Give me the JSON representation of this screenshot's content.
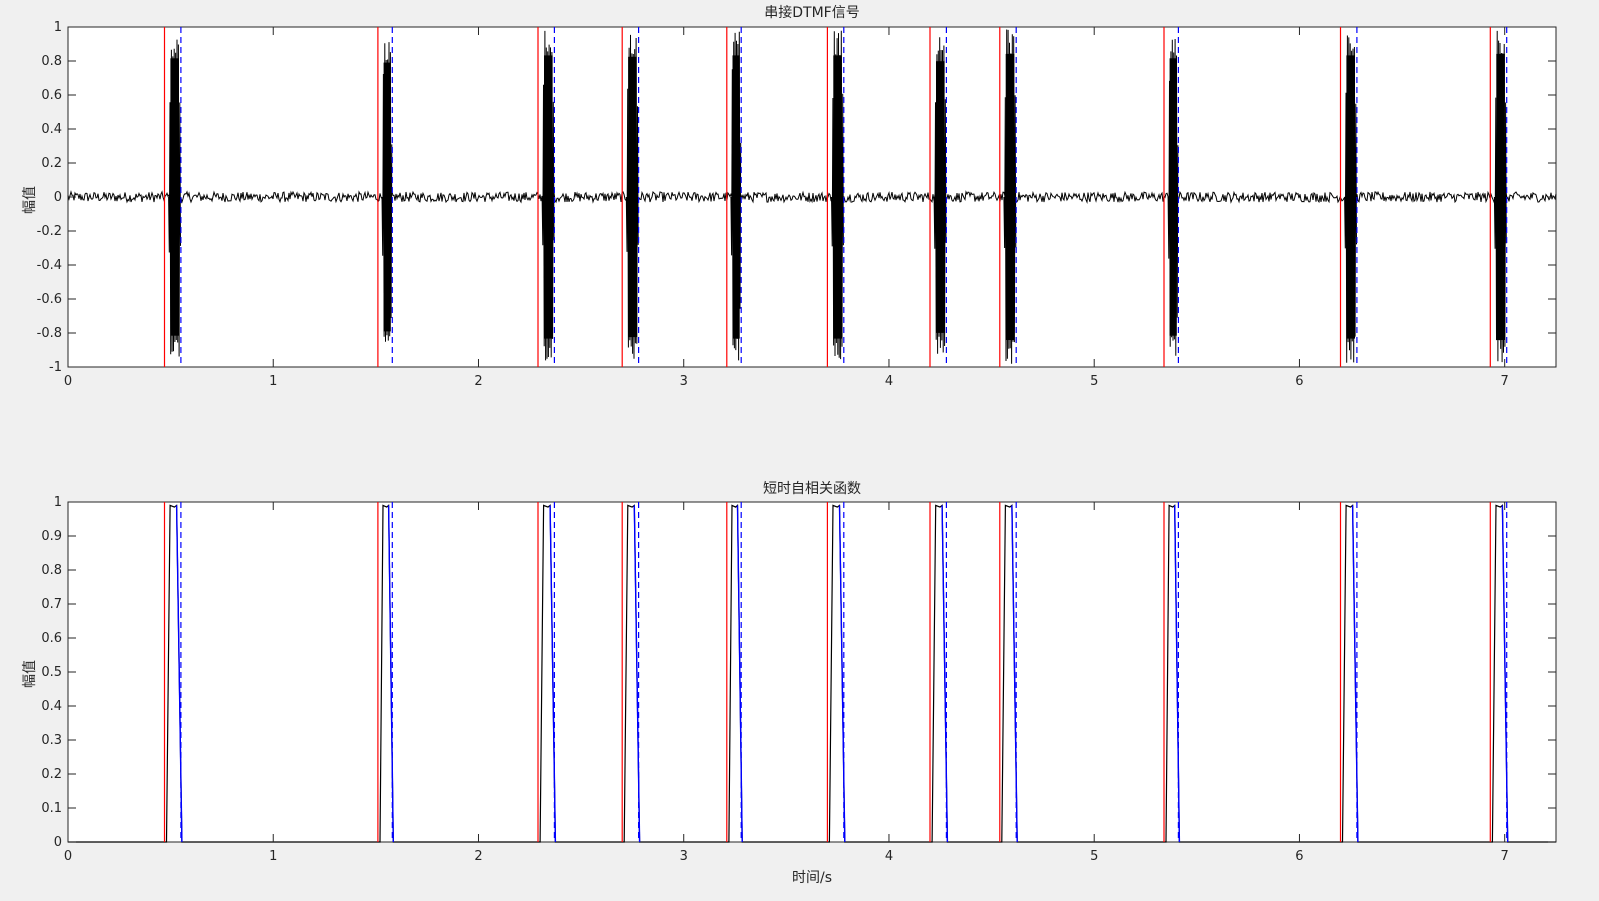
{
  "chart_data": [
    {
      "type": "line",
      "title": "串接DTMF信号",
      "xlabel": "",
      "ylabel": "幅值",
      "xlim": [
        0,
        7.25
      ],
      "ylim": [
        -1,
        1
      ],
      "xticks": [
        "0",
        "1",
        "2",
        "3",
        "4",
        "5",
        "6",
        "7"
      ],
      "yticks": [
        "-1",
        "-0.8",
        "-0.6",
        "-0.4",
        "-0.2",
        "0",
        "0.2",
        "0.4",
        "0.6",
        "0.8",
        "1"
      ],
      "grid": false,
      "noise_amplitude": 0.03,
      "series": [
        {
          "kind": "tone-bursts",
          "color": "#000000",
          "bursts": [
            {
              "start": 0.49,
              "end": 0.55,
              "peak": 0.96
            },
            {
              "start": 1.53,
              "end": 1.58,
              "peak": 0.93
            },
            {
              "start": 2.31,
              "end": 2.37,
              "peak": 0.98
            },
            {
              "start": 2.72,
              "end": 2.78,
              "peak": 0.97
            },
            {
              "start": 3.23,
              "end": 3.28,
              "peak": 0.98
            },
            {
              "start": 3.72,
              "end": 3.78,
              "peak": 0.98
            },
            {
              "start": 4.22,
              "end": 4.28,
              "peak": 0.94
            },
            {
              "start": 4.56,
              "end": 4.62,
              "peak": 0.99
            },
            {
              "start": 5.36,
              "end": 5.41,
              "peak": 0.96
            },
            {
              "start": 6.22,
              "end": 6.28,
              "peak": 0.98
            },
            {
              "start": 6.95,
              "end": 7.01,
              "peak": 0.99
            }
          ]
        }
      ],
      "start_markers": [
        0.47,
        1.51,
        2.29,
        2.7,
        3.21,
        3.7,
        4.2,
        4.54,
        5.34,
        6.2,
        6.93
      ],
      "end_markers": [
        0.55,
        1.58,
        2.37,
        2.78,
        3.28,
        3.78,
        4.28,
        4.62,
        5.41,
        6.28,
        7.01
      ],
      "start_color": "#ff0000",
      "end_color": "#0000ff"
    },
    {
      "type": "line",
      "title": "短时自相关函数",
      "xlabel": "时间/s",
      "ylabel": "幅值",
      "xlim": [
        0,
        7.25
      ],
      "ylim": [
        0,
        1
      ],
      "xticks": [
        "0",
        "1",
        "2",
        "3",
        "4",
        "5",
        "6",
        "7"
      ],
      "yticks": [
        "0",
        "0.1",
        "0.2",
        "0.3",
        "0.4",
        "0.5",
        "0.6",
        "0.7",
        "0.8",
        "0.9",
        "1"
      ],
      "grid": false,
      "series": [
        {
          "kind": "pulses",
          "color": "#000000",
          "baseline": 0,
          "plateau": 0.99,
          "pulses": [
            {
              "rise": 0.48,
              "end": 0.55
            },
            {
              "rise": 1.52,
              "end": 1.58
            },
            {
              "rise": 2.3,
              "end": 2.37
            },
            {
              "rise": 2.71,
              "end": 2.78
            },
            {
              "rise": 3.22,
              "end": 3.28
            },
            {
              "rise": 3.71,
              "end": 3.78
            },
            {
              "rise": 4.21,
              "end": 4.28
            },
            {
              "rise": 4.55,
              "end": 4.62
            },
            {
              "rise": 5.35,
              "end": 5.41
            },
            {
              "rise": 6.21,
              "end": 6.28
            },
            {
              "rise": 6.94,
              "end": 7.01
            }
          ]
        }
      ],
      "start_markers": [
        0.47,
        1.51,
        2.29,
        2.7,
        3.21,
        3.7,
        4.2,
        4.54,
        5.34,
        6.2,
        6.93
      ],
      "end_markers": [
        0.55,
        1.58,
        2.37,
        2.78,
        3.28,
        3.78,
        4.28,
        4.62,
        5.41,
        6.28,
        7.01
      ],
      "start_color": "#ff0000",
      "end_color": "#0000ff"
    }
  ]
}
